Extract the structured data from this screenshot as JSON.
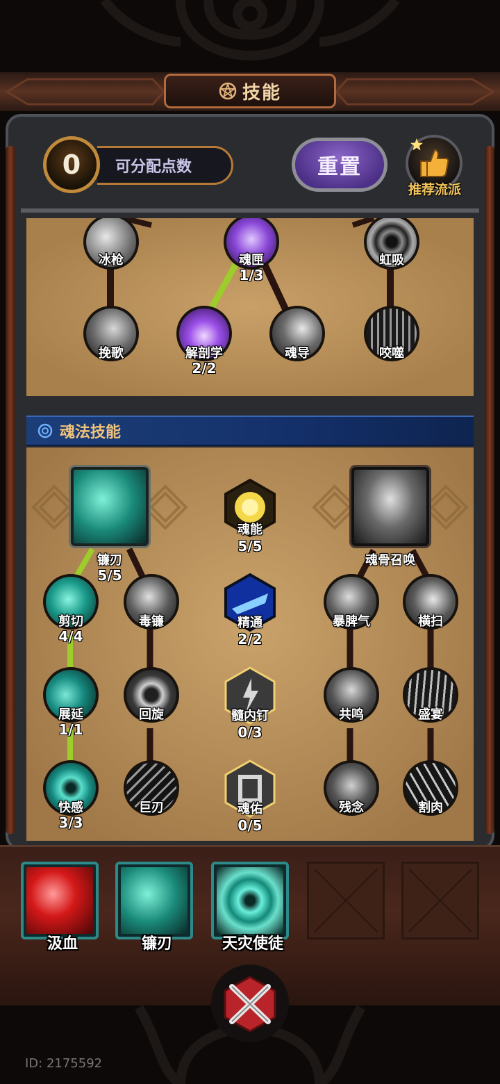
{
  "header": {
    "title": "技能",
    "title_icon": "pentagram-icon"
  },
  "points": {
    "value": "0",
    "label": "可分配点数"
  },
  "buttons": {
    "reset": "重置",
    "recommend": "推荐流派"
  },
  "tree_top": {
    "nodes": [
      {
        "id": "ice-spear",
        "label": "冰枪",
        "count": ""
      },
      {
        "id": "soul-box",
        "label": "魂匣",
        "count": "1/3"
      },
      {
        "id": "rainbow-absorb",
        "label": "虹吸",
        "count": ""
      },
      {
        "id": "elegy",
        "label": "挽歌",
        "count": ""
      },
      {
        "id": "anatomy",
        "label": "解剖学",
        "count": "2/2"
      },
      {
        "id": "soul-guide",
        "label": "魂导",
        "count": ""
      },
      {
        "id": "devour",
        "label": "咬噬",
        "count": ""
      }
    ]
  },
  "section": {
    "title": "魂法技能"
  },
  "tree_bottom": {
    "nodes": [
      {
        "id": "scythe-blade",
        "label": "镰刃",
        "count": "5/5"
      },
      {
        "id": "soul-energy",
        "label": "魂能",
        "count": "5/5"
      },
      {
        "id": "bone-summon",
        "label": "魂骨召唤",
        "count": ""
      },
      {
        "id": "shear",
        "label": "剪切",
        "count": "4/4"
      },
      {
        "id": "poison-scythe",
        "label": "毒镰",
        "count": ""
      },
      {
        "id": "mastery",
        "label": "精通",
        "count": "2/2"
      },
      {
        "id": "temper",
        "label": "暴脾气",
        "count": ""
      },
      {
        "id": "sweep",
        "label": "横扫",
        "count": ""
      },
      {
        "id": "extend",
        "label": "展延",
        "count": "1/1"
      },
      {
        "id": "spin",
        "label": "回旋",
        "count": ""
      },
      {
        "id": "marrow-nail",
        "label": "髓内钉",
        "count": "0/3"
      },
      {
        "id": "resonance",
        "label": "共鸣",
        "count": ""
      },
      {
        "id": "feast",
        "label": "盛宴",
        "count": ""
      },
      {
        "id": "pleasure",
        "label": "快感",
        "count": "3/3"
      },
      {
        "id": "giant-blade",
        "label": "巨刃",
        "count": ""
      },
      {
        "id": "soul-bless",
        "label": "魂佑",
        "count": "0/5"
      },
      {
        "id": "lingering",
        "label": "残念",
        "count": ""
      },
      {
        "id": "cut-flesh",
        "label": "割肉",
        "count": ""
      }
    ]
  },
  "equipped": {
    "slots": [
      {
        "label": "汲血",
        "filled": true
      },
      {
        "label": "镰刃",
        "filled": true
      },
      {
        "label": "天灾使徒",
        "filled": true
      },
      {
        "label": "",
        "filled": false
      },
      {
        "label": "",
        "filled": false
      }
    ]
  },
  "footer": {
    "close_icon": "crossed-blades-close-icon",
    "id_text": "ID: 2175592"
  },
  "colors": {
    "accent_gold": "#f1c27a",
    "active_link": "#9ccd2a",
    "inactive_link": "#2a1410",
    "section_blue": "#14306a"
  }
}
